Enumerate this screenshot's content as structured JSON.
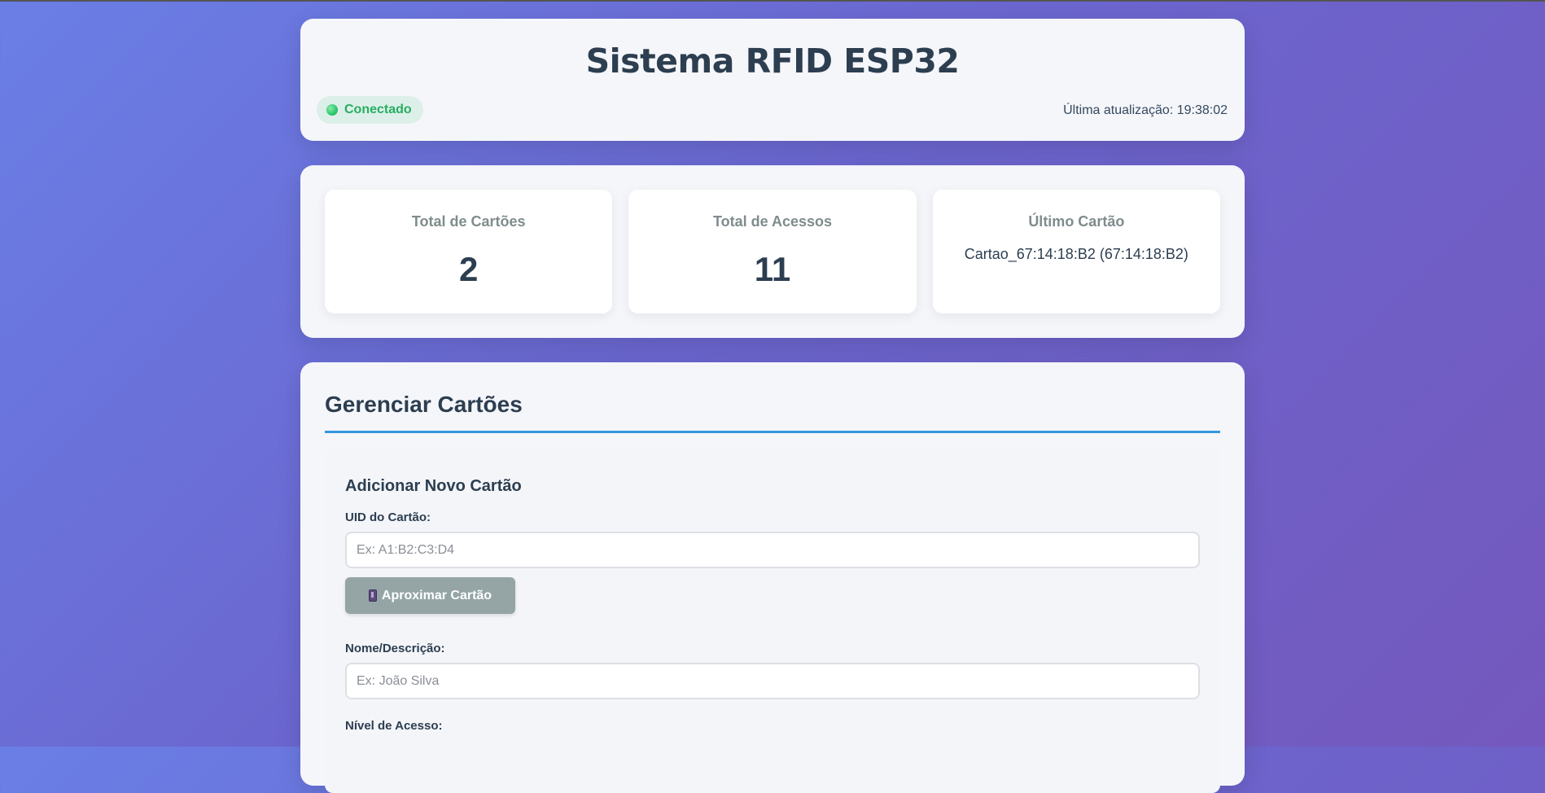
{
  "header": {
    "title": "Sistema RFID ESP32",
    "status": "Conectado",
    "last_update": "Última atualização: 19:38:02"
  },
  "stats": {
    "total_cards_label": "Total de Cartões",
    "total_cards_value": "2",
    "total_access_label": "Total de Acessos",
    "total_access_value": "11",
    "last_card_label": "Último Cartão",
    "last_card_value": "Cartao_67:14:18:B2 (67:14:18:B2)"
  },
  "manage": {
    "title": "Gerenciar Cartões",
    "form_title": "Adicionar Novo Cartão",
    "uid_label": "UID do Cartão:",
    "uid_placeholder": "Ex: A1:B2:C3:D4",
    "scan_button": "Aproximar Cartão",
    "name_label": "Nome/Descrição:",
    "name_placeholder": "Ex: João Silva",
    "level_label": "Nível de Acesso:"
  },
  "colors": {
    "accent": "#3498db",
    "connected": "#27ae60",
    "scan_button": "#95a5a6"
  }
}
